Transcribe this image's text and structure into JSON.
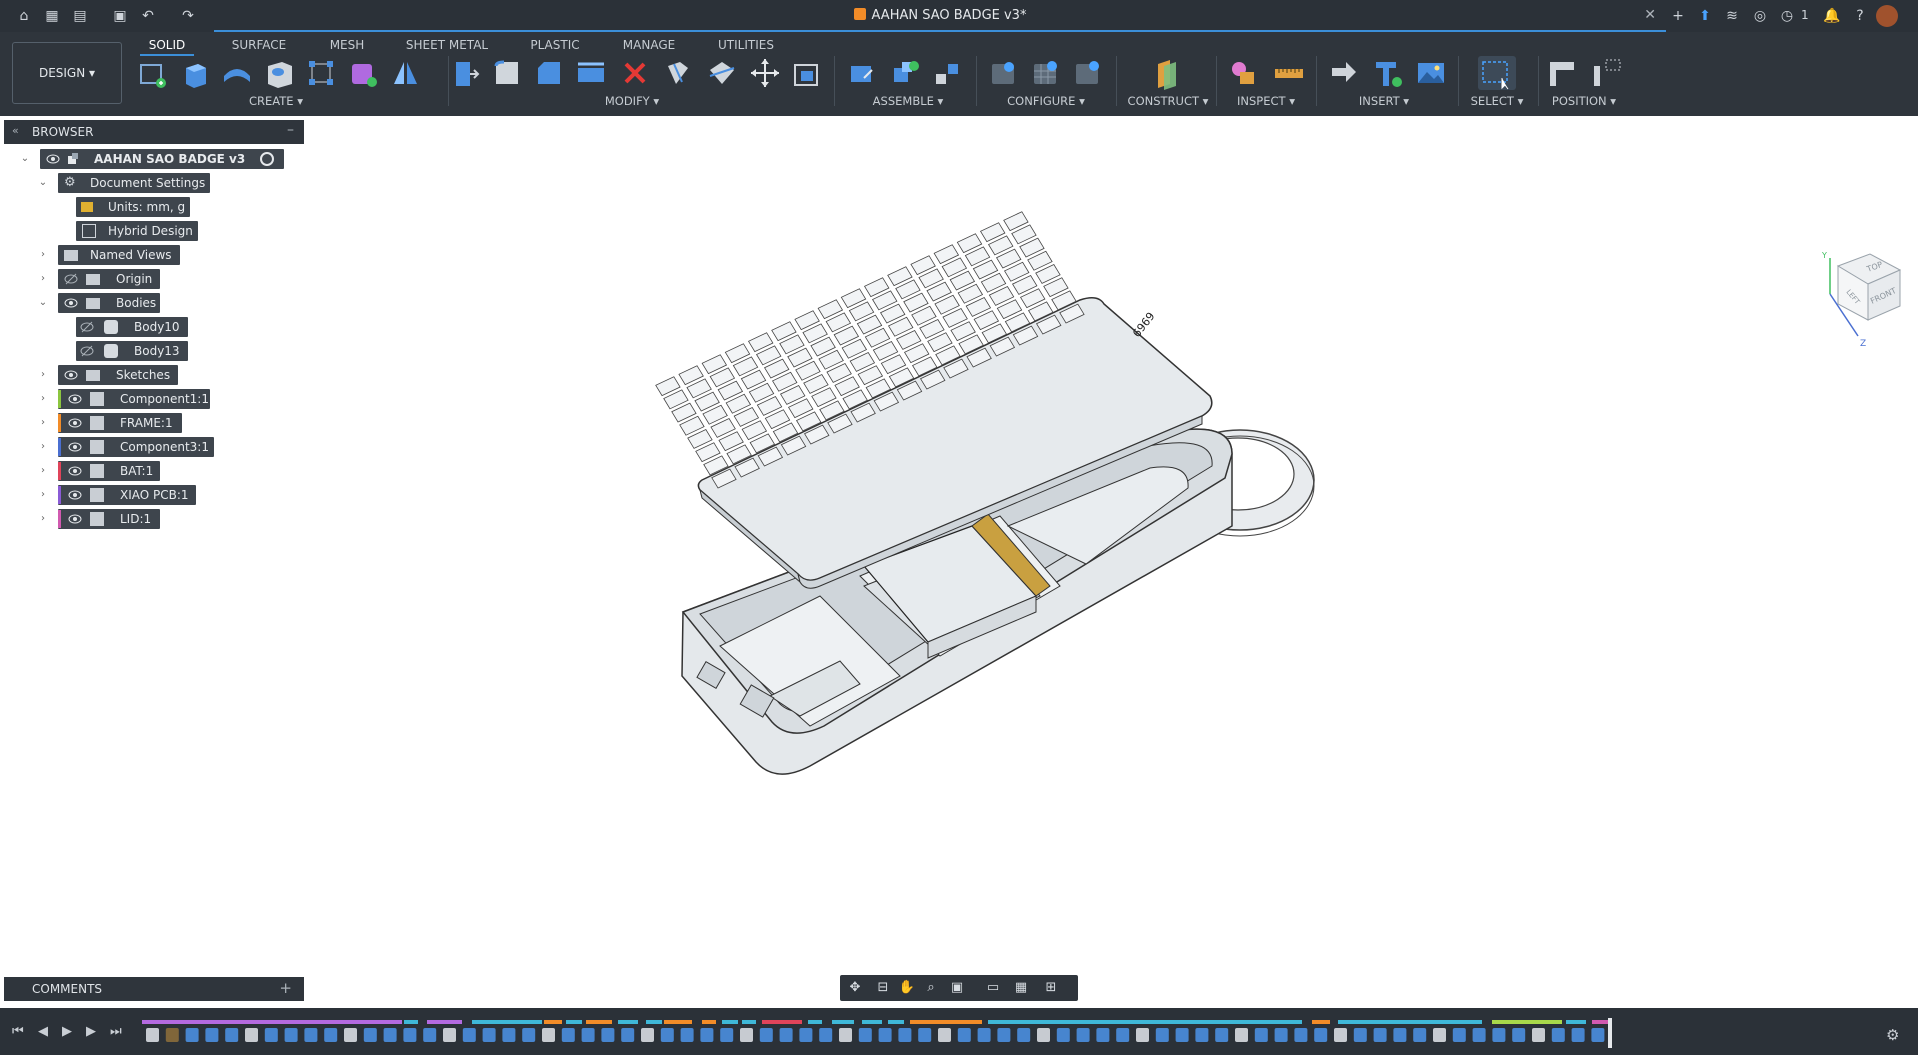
{
  "titlebar": {
    "doc_title": "AAHAN SAO BADGE v3*",
    "notification_count": "1",
    "icons": [
      "home-icon",
      "grid-icon",
      "file-icon",
      "save-icon",
      "undo-icon",
      "redo-icon",
      "close-tab-icon",
      "new-tab-icon",
      "cloud-upload-icon",
      "extensions-icon",
      "offline-icon",
      "job-status-icon",
      "notifications-icon",
      "help-icon",
      "user-avatar"
    ]
  },
  "toolbar": {
    "workspace_button": "DESIGN ▾",
    "tabs": [
      "SOLID",
      "SURFACE",
      "MESH",
      "SHEET METAL",
      "PLASTIC",
      "MANAGE",
      "UTILITIES"
    ],
    "active_tab": "SOLID",
    "groups": [
      "CREATE ▾",
      "MODIFY ▾",
      "ASSEMBLE ▾",
      "CONFIGURE ▾",
      "CONSTRUCT ▾",
      "INSPECT ▾",
      "INSERT ▾",
      "SELECT ▾",
      "POSITION ▾"
    ],
    "accent_color": "#3b8fd9"
  },
  "browser": {
    "header": "BROWSER",
    "root": "AAHAN SAO BADGE v3",
    "items": [
      {
        "label": "Document Settings",
        "icon": "gear-icon"
      },
      {
        "label": "Units: mm, g",
        "icon": "ruler-icon"
      },
      {
        "label": "Hybrid Design",
        "icon": "document-icon"
      },
      {
        "label": "Named Views",
        "icon": "folder-icon"
      },
      {
        "label": "Origin",
        "icon": "folder-icon"
      },
      {
        "label": "Bodies",
        "icon": "folder-icon"
      },
      {
        "label": "Body10",
        "icon": "body-icon"
      },
      {
        "label": "Body13",
        "icon": "body-icon"
      },
      {
        "label": "Sketches",
        "icon": "folder-icon"
      },
      {
        "label": "Component1:1",
        "icon": "component-icon",
        "color": "#8cc63f"
      },
      {
        "label": "FRAME:1",
        "icon": "component-icon",
        "color": "#f28c28"
      },
      {
        "label": "Component3:1",
        "icon": "component-icon",
        "color": "#4a6fd1"
      },
      {
        "label": "BAT:1",
        "icon": "component-icon",
        "color": "#e0445a"
      },
      {
        "label": "XIAO PCB:1",
        "icon": "component-icon",
        "color": "#8a5bd6"
      },
      {
        "label": "LID:1",
        "icon": "component-icon",
        "color": "#d15ab0"
      }
    ]
  },
  "viewcube": {
    "top": "TOP",
    "front": "FRONT",
    "left": "LEFT",
    "axis_y": "Y",
    "axis_z": "Z"
  },
  "model": {
    "lid_text": "6969"
  },
  "comments": {
    "header": "COMMENTS"
  },
  "timeline": {
    "icons": [
      "first-icon",
      "previous-icon",
      "play-icon",
      "next-icon",
      "last-icon",
      "timeline-settings-icon"
    ]
  }
}
